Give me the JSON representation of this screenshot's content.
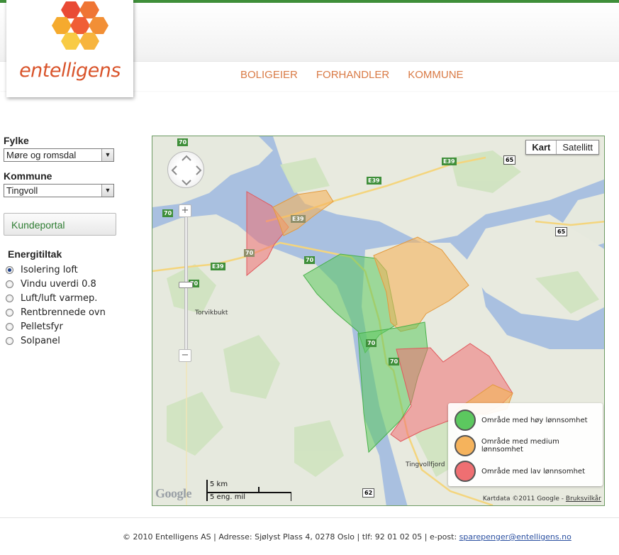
{
  "brand": {
    "name": "entelligens"
  },
  "nav": [
    "BOLIGEIER",
    "FORHANDLER",
    "KOMMUNE"
  ],
  "sidebar": {
    "fylke_label": "Fylke",
    "fylke_value": "Møre og romsdal",
    "kommune_label": "Kommune",
    "kommune_value": "Tingvoll",
    "portal_button": "Kundeportal",
    "energi_title": "Energitiltak",
    "options": [
      {
        "label": "Isolering loft",
        "selected": true
      },
      {
        "label": "Vindu uverdi 0.8",
        "selected": false
      },
      {
        "label": "Luft/luft varmep.",
        "selected": false
      },
      {
        "label": "Rentbrennede ovn",
        "selected": false
      },
      {
        "label": "Pelletsfyr",
        "selected": false
      },
      {
        "label": "Solpanel",
        "selected": false
      }
    ]
  },
  "map": {
    "type_kart": "Kart",
    "type_satellitt": "Satellitt",
    "zoom_in": "+",
    "zoom_out": "−",
    "places": {
      "torvikbukt": "Torvikbukt",
      "tingvollfjord": "Tingvollfjord"
    },
    "roads": {
      "e39": "E39",
      "r70": "70",
      "r65": "65",
      "r62": "62"
    },
    "legend": [
      {
        "label": "Område med høy lønnsomhet",
        "color": "#5cc85f"
      },
      {
        "label": "Område med medium lønnsomhet",
        "color": "#f5b35c"
      },
      {
        "label": "Område med lav lønnsomhet",
        "color": "#ef6f72"
      }
    ],
    "scale_km": "5 km",
    "scale_mil": "5 eng. mil",
    "google": "Google",
    "attribution": "Kartdata ©2011 Google -",
    "terms": "Bruksvilkår"
  },
  "footer": {
    "text": "© 2010 Entelligens AS | Adresse: Sjølyst Plass 4, 0278 Oslo | tlf: 92 01 02 05 | e-post:",
    "email": "sparepenger@entelligens.no"
  }
}
